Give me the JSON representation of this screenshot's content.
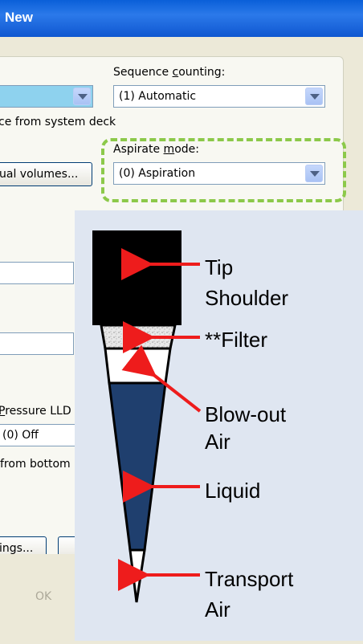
{
  "window": {
    "title": "New"
  },
  "dialog": {
    "sequence_counting": {
      "label_pre": "Sequence ",
      "label_key": "c",
      "label_post": "ounting:",
      "value": "(1) Automatic"
    },
    "sequence_source_text": "ce from system deck",
    "individual_volumes_button": "ual volumes...",
    "aspirate_mode": {
      "label_pre": "Aspirate ",
      "label_key": "m",
      "label_post": "ode:",
      "value": "(0) Aspiration"
    },
    "pressure_lld": {
      "label_key": "P",
      "label_post": "ressure LLD",
      "value": "(0) Off"
    },
    "from_bottom_text": "from bottom",
    "settings_button": "ings...",
    "ok_button": "OK"
  },
  "diagram": {
    "labels": {
      "tip_shoulder_1": "Tip",
      "tip_shoulder_2": "Shoulder",
      "filter": "**Filter",
      "blowout_1": "Blow-out",
      "blowout_2": "Air",
      "liquid": "Liquid",
      "transport_1": "Transport",
      "transport_2": "Air"
    },
    "colors": {
      "shoulder": "#000000",
      "filter": "#d9d9d9",
      "liquid": "#1f3f6e",
      "arrow": "#ee1c1c",
      "highlight": "#8cc94a"
    }
  }
}
